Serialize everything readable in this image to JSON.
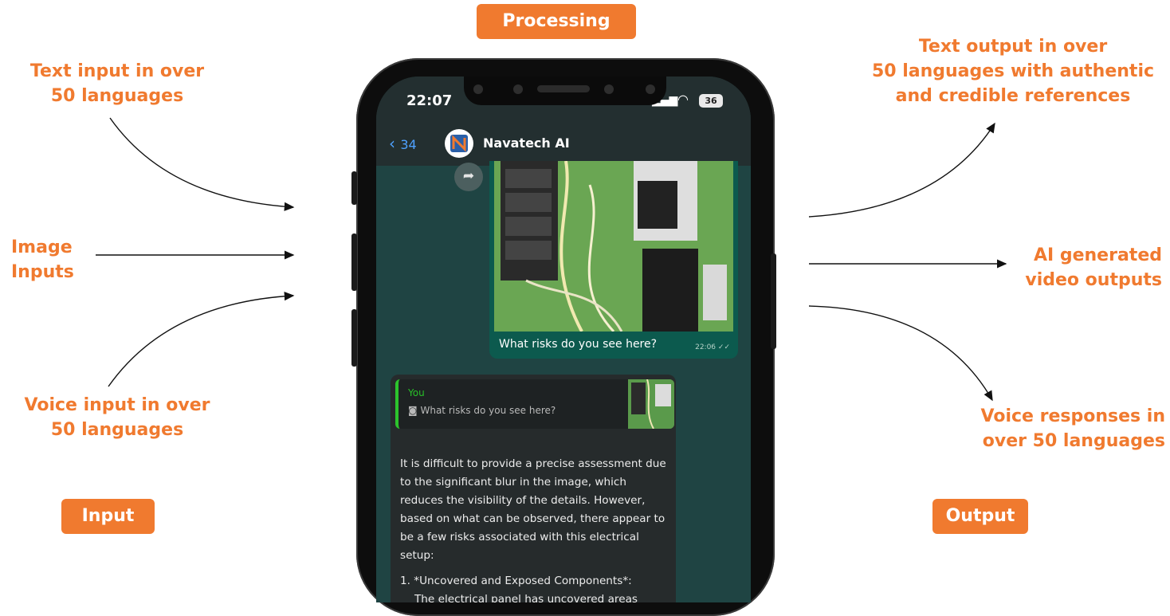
{
  "diagram": {
    "processing_label": "Processing",
    "input_label": "Input",
    "output_label": "Output",
    "inputs": [
      {
        "line1": "Text input in over",
        "line2": "50 languages"
      },
      {
        "line1": "Image",
        "line2": "Inputs"
      },
      {
        "line1": "Voice input in over",
        "line2": "50 languages"
      }
    ],
    "outputs": [
      {
        "line1": "Text output in over",
        "line2": "50 languages with authentic",
        "line3": "and credible references"
      },
      {
        "line1": "AI generated",
        "line2": "video outputs"
      },
      {
        "line1": "Voice responses in",
        "line2": "over 50 languages"
      }
    ],
    "accent_color": "#f07a2f"
  },
  "phone": {
    "status_time": "22:07",
    "battery": "36",
    "back_count": "34",
    "contact_name": "Navatech AI",
    "image_message": {
      "caption": "What risks do you see here?",
      "time": "22:06"
    },
    "reply": {
      "quoted_author": "You",
      "quoted_text": "What risks do you see here?",
      "body": "It is difficult to provide a precise assessment due to the significant blur in the image, which reduces the visibility of the details. However, based on what can be observed, there appear to be a few risks associated with this electrical setup:",
      "point_title": "1. *Uncovered and Exposed Components*:",
      "point_body": "The electrical panel has uncovered areas"
    }
  }
}
